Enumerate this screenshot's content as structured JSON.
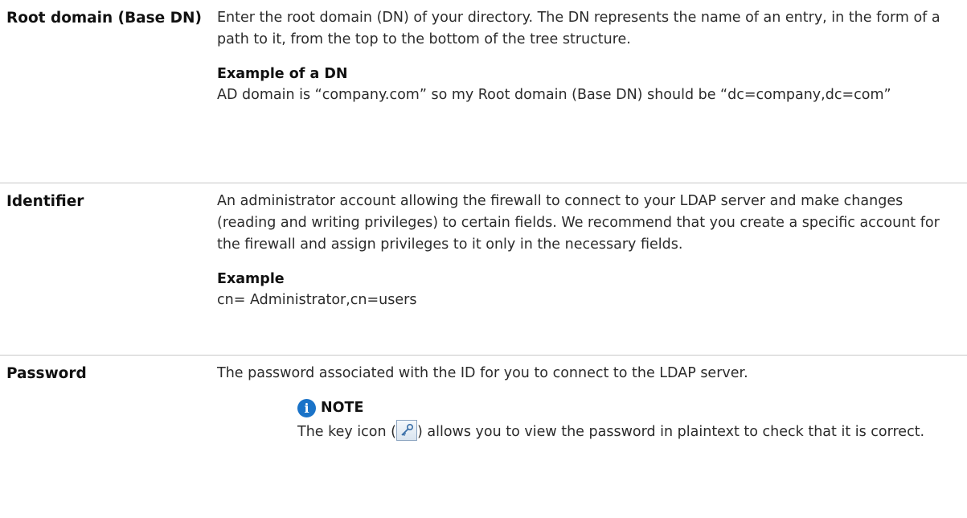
{
  "rows": [
    {
      "term": "Root domain (Base DN)",
      "description": "Enter the root domain (DN) of your directory. The DN represents the name of an entry, in the form of a path to it, from the top to the bottom of the tree structure.",
      "example_title": "Example of a DN",
      "example_text": "AD domain is “company.com” so my Root domain (Base DN) should be “dc=company,dc=com”"
    },
    {
      "term": "Identifier",
      "description": "An administrator account allowing the firewall to connect to your LDAP server and make changes (reading and writing privileges) to certain fields. We recommend that you create a specific account for the firewall and assign privileges to it only in the necessary fields.",
      "example_title": "Example",
      "example_text": "cn= Administrator,cn=users"
    },
    {
      "term": "Password",
      "description": "The password associated with the ID for you to connect to the LDAP server.",
      "note": {
        "title": "NOTE",
        "text_before": "The key icon (",
        "text_after": ") allows you to view the password in plaintext to check that it is correct.",
        "icon": "key-icon"
      }
    }
  ],
  "colors": {
    "info_icon": "#1a73c8",
    "divider": "#c8c8c8"
  }
}
